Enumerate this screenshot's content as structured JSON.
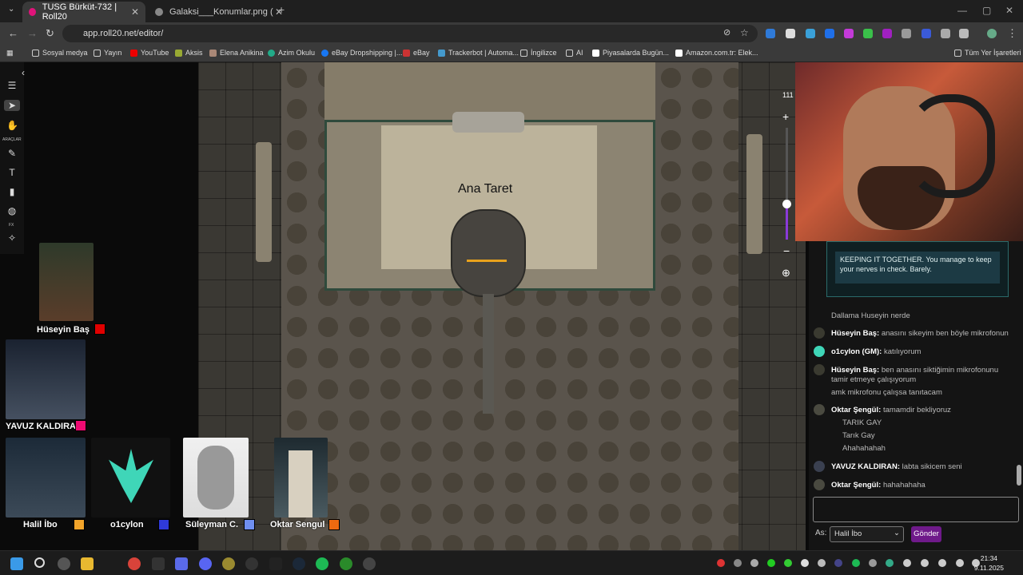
{
  "browser": {
    "tabs": [
      {
        "label": "TUSG Bürküt-732 | Roll20",
        "active": true
      },
      {
        "label": "Galaksi___Konumlar.png (2970×",
        "active": false
      }
    ],
    "url": "app.roll20.net/editor/",
    "bookmarks": [
      "Sosyal medya",
      "Yayın",
      "YouTube",
      "Aksis",
      "Elena Anikina",
      "Azim Okulu",
      "eBay Dropshipping |...",
      "eBay",
      "Trackerbot | Automa...",
      "İngilizce",
      "AI",
      "Piyasalarda Bugün...",
      "Amazon.com.tr: Elek..."
    ],
    "all_bookmarks": "Tüm Yer İşaretleri"
  },
  "toolbar": {
    "tools_label": "ARAÇLAR",
    "fx_label": "FX"
  },
  "map": {
    "turret_label": "Ana Taret",
    "zoom_value": "111"
  },
  "players": [
    {
      "name": "Hüseyin Baş",
      "color": "#e00000"
    },
    {
      "name": "YAVUZ KALDIRAN",
      "color": "#ee0a72"
    },
    {
      "name": "Halil İbo",
      "color": "#f2a42a"
    },
    {
      "name": "o1cylon",
      "color": "#2f3ad8"
    },
    {
      "name": "Süleyman C.",
      "color": "#6f8ff0"
    },
    {
      "name": "Oktar Sengul",
      "color": "#ee6a10"
    }
  ],
  "chat": {
    "roll_text": "KEEPING IT TOGETHER. You manage to keep your nerves in check. Barely.",
    "messages": [
      {
        "author": "",
        "text": "Dallama Huseyin nerde"
      },
      {
        "author": "Hüseyin Baş:",
        "text": "anasını sikeyim ben böyle mikrofonun"
      },
      {
        "author": "o1cylon (GM):",
        "text": "katılıyorum"
      },
      {
        "author": "Hüseyin Baş:",
        "text": "ben anasını siktiğimin mikrofonunu tamir etmeye çalışıyorum"
      },
      {
        "author": "",
        "text": "amk mikrofonu çalışsa tanıtacam"
      },
      {
        "author": "Oktar Şengül:",
        "text": "tamamdir bekliyoruz"
      },
      {
        "author": "",
        "text": "TARIK GAY"
      },
      {
        "author": "",
        "text": "Tarık Gay"
      },
      {
        "author": "",
        "text": "Ahahahahah"
      },
      {
        "author": "YAVUZ KALDIRAN:",
        "text": "labta sikicem seni"
      },
      {
        "author": "Oktar Şengül:",
        "text": "hahahahaha"
      }
    ],
    "as_label": "As:",
    "as_value": "Halil İbo",
    "send_label": "Gönder"
  },
  "taskbar": {
    "time": "21:34",
    "date": "9.11.2025"
  }
}
